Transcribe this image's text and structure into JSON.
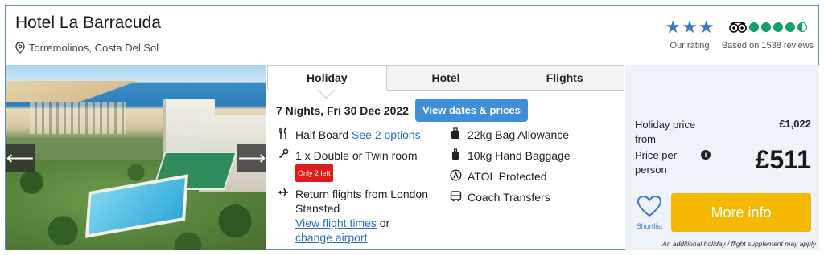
{
  "hotel": {
    "name": "Hotel La Barracuda",
    "location": "Torremolinos, Costa Del Sol"
  },
  "rating": {
    "stars": 3,
    "label": "Our rating"
  },
  "tripadvisor": {
    "score": 4.5,
    "label": "Based on 1538 reviews",
    "color": "#14a06a"
  },
  "tabs": [
    {
      "label": "Holiday",
      "active": true
    },
    {
      "label": "Hotel",
      "active": false
    },
    {
      "label": "Flights",
      "active": false
    }
  ],
  "trip": {
    "nights_date": "7 Nights, Fri 30 Dec 2022",
    "dates_button": "View dates & prices"
  },
  "features_left": {
    "board": "Half Board",
    "board_link": "See 2 options",
    "room": "1 x Double or Twin room",
    "room_badge": "Only 2 left",
    "flights": "Return flights from London Stansted",
    "flight_times_link": "View flight times",
    "or": " or",
    "change_airport_link": "change airport"
  },
  "features_right": {
    "bag": "22kg Bag Allowance",
    "hand": "10kg Hand Baggage",
    "atol": "ATOL Protected",
    "transfer": "Coach Transfers"
  },
  "price": {
    "holiday_label": "Holiday price from",
    "holiday_value": "£1,022",
    "pp_label": "Price per person",
    "pp_value": "£511",
    "shortlist": "Shortlist",
    "more_info": "More info",
    "supplement": "An additional holiday / flight supplement may apply"
  },
  "colors": {
    "accent": "#3b78c2",
    "button_blue": "#3e8fd8",
    "cta": "#f5b800",
    "badge": "#e01b1b"
  }
}
